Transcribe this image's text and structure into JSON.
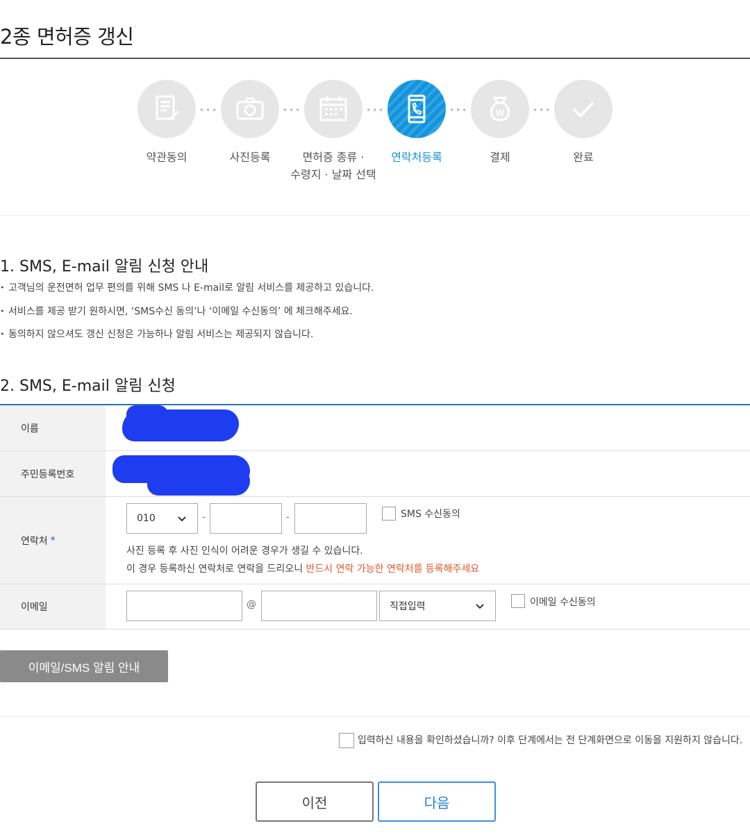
{
  "page": {
    "title": "2종 면허증 갱신"
  },
  "steps": [
    {
      "label_line1": "약관동의",
      "label_line2": "",
      "icon": "document-pen-icon",
      "active": false
    },
    {
      "label_line1": "사진등록",
      "label_line2": "",
      "icon": "camera-icon",
      "active": false
    },
    {
      "label_line1": "면허증 종류 ·",
      "label_line2": "수령지 · 날짜 선택",
      "icon": "calendar-icon",
      "active": false
    },
    {
      "label_line1": "연락처등록",
      "label_line2": "",
      "icon": "phone-icon",
      "active": true
    },
    {
      "label_line1": "결제",
      "label_line2": "",
      "icon": "won-bag-icon",
      "active": false
    },
    {
      "label_line1": "완료",
      "label_line2": "",
      "icon": "check-icon",
      "active": false
    }
  ],
  "section1": {
    "title": "1. SMS, E-mail 알림 신청 안내",
    "bullets": [
      "고객님의 운전면허 업무 편의를 위해 SMS 나 E-mail로 알림 서비스를 제공하고 있습니다.",
      "서비스를 제공 받기 원하시면, ‘SMS수신 동의’나 ‘이메일 수신동의’ 에 체크해주세요.",
      "동의하지 않으셔도 갱신 신청은 가능하나 알림 서비스는 제공되지 않습니다."
    ]
  },
  "section2": {
    "title": "2. SMS, E-mail 알림 신청",
    "name_label": "이름",
    "rrn_label": "주민등록번호",
    "phone_label": "연락처",
    "required_mark": "*",
    "phone_prefix": "010",
    "dash": "-",
    "sms_consent_label": "SMS 수신동의",
    "phone_note_line1": "사진 등록 후 사진 인식이 어려운 경우가 생길 수 있습니다.",
    "phone_note_line2_plain": "이 경우 등록하신 연락처로 연락을 드리오니 ",
    "phone_note_line2_red": "반드시 연락 가능한 연락처를 등록해주세요",
    "email_label": "이메일",
    "at_sign": "@",
    "email_domain_select": "직접입력",
    "email_consent_label": "이메일 수신동의"
  },
  "guide_button": "이메일/SMS 알림 안내",
  "confirm_label": "입력하신 내용을 확인하셨습니까? 이후 단계에서는 전 단계화면으로 이동을 지원하지 않습니다.",
  "buttons": {
    "prev": "이전",
    "next": "다음"
  },
  "colors": {
    "accent": "#1a8fd6",
    "table_top_border": "#2c6fb8",
    "note_red": "#e0572a",
    "redaction": "#1e3cf0"
  }
}
